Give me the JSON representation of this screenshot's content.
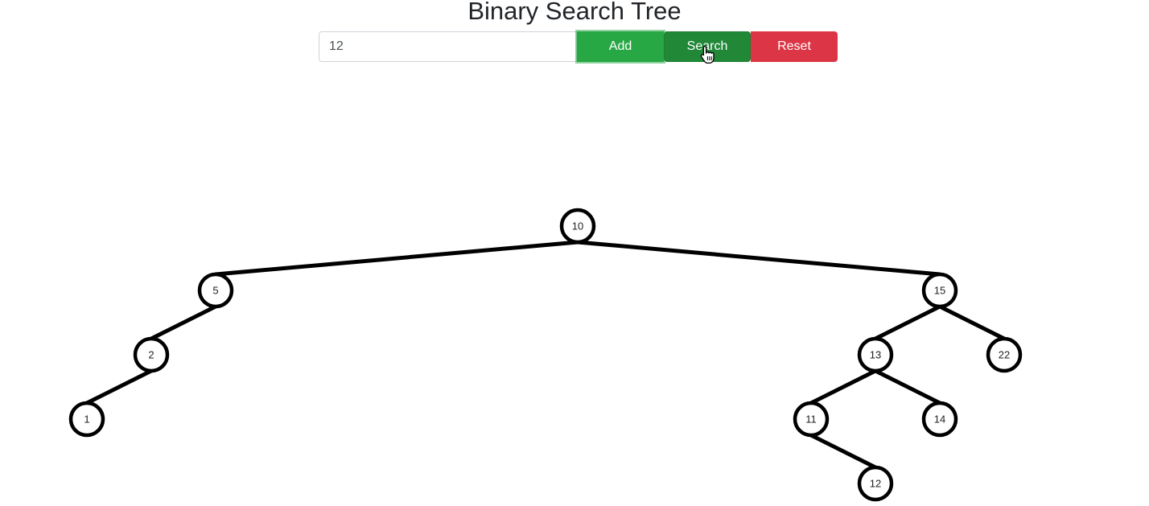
{
  "header": {
    "title": "Binary Search Tree"
  },
  "controls": {
    "input_value": "12",
    "add_label": "Add",
    "search_label": "Search",
    "reset_label": "Reset"
  },
  "colors": {
    "add": "#28a745",
    "search": "#218838",
    "reset": "#dc3545",
    "node_stroke": "#000000"
  },
  "tree": {
    "nodes": [
      {
        "id": "10",
        "label": "10"
      },
      {
        "id": "5",
        "label": "5"
      },
      {
        "id": "15",
        "label": "15"
      },
      {
        "id": "2",
        "label": "2"
      },
      {
        "id": "1",
        "label": "1"
      },
      {
        "id": "13",
        "label": "13"
      },
      {
        "id": "22",
        "label": "22"
      },
      {
        "id": "11",
        "label": "11"
      },
      {
        "id": "14",
        "label": "14"
      },
      {
        "id": "12",
        "label": "12"
      }
    ],
    "edges": [
      [
        "10",
        "5"
      ],
      [
        "10",
        "15"
      ],
      [
        "5",
        "2"
      ],
      [
        "2",
        "1"
      ],
      [
        "15",
        "13"
      ],
      [
        "15",
        "22"
      ],
      [
        "13",
        "11"
      ],
      [
        "13",
        "14"
      ],
      [
        "11",
        "12"
      ]
    ]
  },
  "cursor": {
    "icon": "hand-pointer-icon"
  }
}
